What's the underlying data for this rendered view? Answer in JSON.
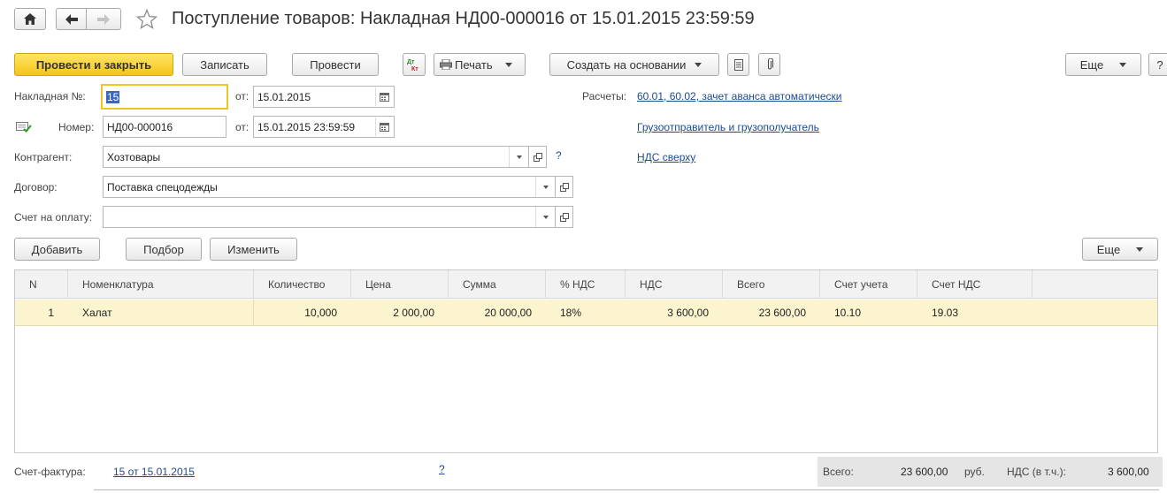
{
  "header": {
    "title": "Поступление товаров: Накладная НД00-000016 от 15.01.2015 23:59:59"
  },
  "toolbar": {
    "post_close": "Провести и закрыть",
    "save": "Записать",
    "post": "Провести",
    "print": "Печать",
    "create_based": "Создать на основании",
    "more": "Еще",
    "help": "?"
  },
  "form": {
    "invoice_label": "Накладная №:",
    "invoice_value": "15",
    "from_label": "от:",
    "invoice_date": "15.01.2015",
    "number_label": "Номер:",
    "number_value": "НД00-000016",
    "number_date": "15.01.2015 23:59:59",
    "counterparty_label": "Контрагент:",
    "counterparty_value": "Хозтовары",
    "counterparty_help": "?",
    "contract_label": "Договор:",
    "contract_value": "Поставка спецодежды",
    "payment_label": "Счет на оплату:",
    "payment_value": "",
    "settlements_label": "Расчеты:",
    "settlements_link": "60.01, 60.02, зачет аванса автоматически",
    "shipper_link": "Грузоотправитель и грузополучатель",
    "vat_link": "НДС сверху"
  },
  "table_toolbar": {
    "add": "Добавить",
    "pick": "Подбор",
    "change": "Изменить",
    "more": "Еще"
  },
  "table": {
    "columns": [
      "N",
      "Номенклатура",
      "Количество",
      "Цена",
      "Сумма",
      "% НДС",
      "НДС",
      "Всего",
      "Счет учета",
      "Счет НДС"
    ],
    "rows": [
      [
        "1",
        "Халат",
        "10,000",
        "2 000,00",
        "20 000,00",
        "18%",
        "3 600,00",
        "23 600,00",
        "10.10",
        "19.03"
      ]
    ]
  },
  "footer": {
    "invoice_label": "Счет-фактура:",
    "invoice_link": "15 от 15.01.2015",
    "help": "?",
    "total_label": "Всего:",
    "total_value": "23 600,00",
    "currency": "руб.",
    "vat_label": "НДС (в т.ч.):",
    "vat_value": "3 600,00"
  },
  "colors": {
    "primary_button": "#f4c51a",
    "link": "#1c4a93",
    "selected_row": "#fbf4cf",
    "focus_border": "#f0c528"
  }
}
